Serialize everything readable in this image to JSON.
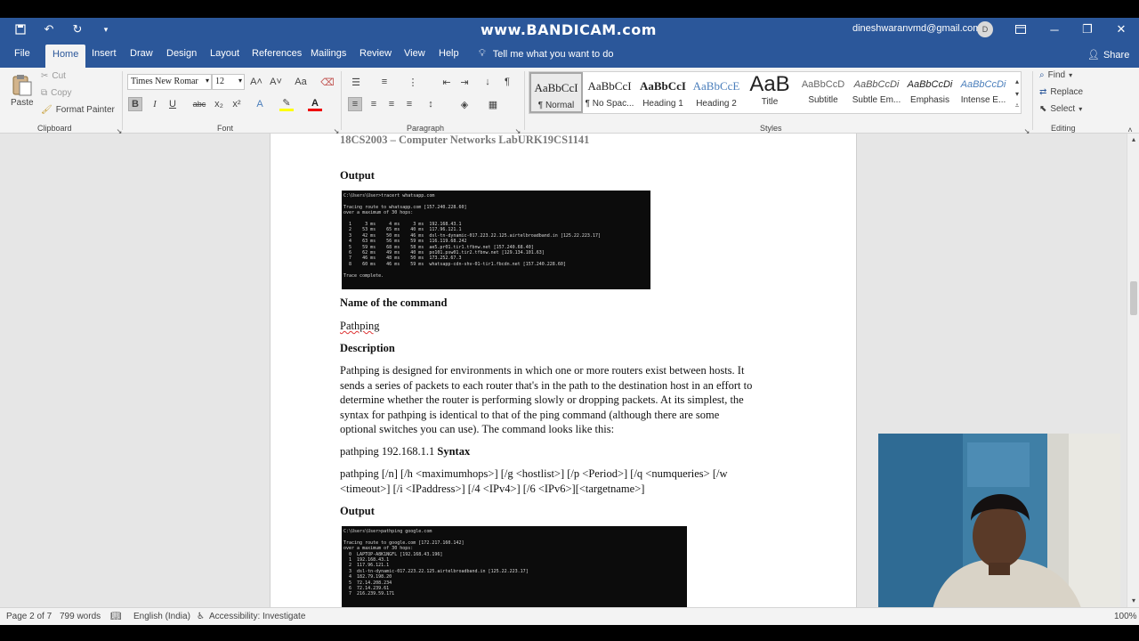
{
  "titlebar": {
    "watermark": "www.BANDICAM.com",
    "account": "dineshwaranvmd@gmail.com",
    "avatar_initial": "D",
    "bg_color": "#2b579a"
  },
  "tabs": [
    {
      "label": "File"
    },
    {
      "label": "Home"
    },
    {
      "label": "Insert"
    },
    {
      "label": "Draw"
    },
    {
      "label": "Design"
    },
    {
      "label": "Layout"
    },
    {
      "label": "References"
    },
    {
      "label": "Mailings"
    },
    {
      "label": "Review"
    },
    {
      "label": "View"
    },
    {
      "label": "Help"
    }
  ],
  "tell_me": "Tell me what you want to do",
  "share": "Share",
  "ribbon": {
    "clipboard": {
      "paste": "Paste",
      "cut": "Cut",
      "copy": "Copy",
      "format_painter": "Format Painter",
      "label": "Clipboard"
    },
    "font": {
      "name": "Times New Romar",
      "size": "12",
      "label": "Font"
    },
    "paragraph": {
      "label": "Paragraph"
    },
    "styles": {
      "label": "Styles",
      "items": [
        {
          "preview": "AaBbCcI",
          "name": "¶ Normal"
        },
        {
          "preview": "AaBbCcI",
          "name": "¶ No Spac..."
        },
        {
          "preview": "AaBbCcI",
          "name": "Heading 1"
        },
        {
          "preview": "AaBbCcE",
          "name": "Heading 2"
        },
        {
          "preview": "AaB",
          "name": "Title"
        },
        {
          "preview": "AaBbCcD",
          "name": "Subtitle"
        },
        {
          "preview": "AaBbCcDi",
          "name": "Subtle Em..."
        },
        {
          "preview": "AaBbCcDi",
          "name": "Emphasis"
        },
        {
          "preview": "AaBbCcDi",
          "name": "Intense E..."
        }
      ]
    },
    "editing": {
      "find": "Find",
      "replace": "Replace",
      "select": "Select",
      "label": "Editing"
    }
  },
  "document": {
    "header": "18CS2003 – Computer Networks LabURK19CS1141",
    "output1": "Output",
    "term1": "C:\\Users\\User>tracert whatsapp.com\n\nTracing route to whatsapp.com [157.240.228.60]\nover a maximum of 30 hops:\n\n  1     3 ms     4 ms     3 ms  192.168.43.1\n  2    53 ms    65 ms    40 ms  117.96.121.1\n  3    42 ms    50 ms    46 ms  dsl-tn-dynamic-017.223.22.125.airtelbroadband.in [125.22.223.17]\n  4    63 ms    56 ms    59 ms  116.119.68.242\n  5    59 ms    68 ms    58 ms  ae5.pr01.tir1.tfbnw.net [157.240.68.40]\n  6    62 ms    49 ms    40 ms  po101.psw01.tir2.tfbnw.net [129.134.101.63]\n  7    46 ms    48 ms    50 ms  173.252.67.3\n  8    60 ms    46 ms    59 ms  whatsapp-cdn-shv-01-tir1.fbcdn.net [157.240.228.60]\n\nTrace complete.",
    "name_heading": "Name of the command",
    "command_name": "Pathping",
    "desc_heading": "Description",
    "desc_lines": [
      "Pathping is designed for environments in which one or more routers exist between hosts. It",
      "sends a series of packets to each router that's in the path to the destination host in an effort to",
      "determine whether the router is performing slowly or dropping packets. At its simplest, the",
      "syntax for pathping is identical to that of the ping command (although there are some",
      "optional switches you can use). The command looks like this:"
    ],
    "example": "pathping 192.168.1.1",
    "syntax_heading": "Syntax",
    "syntax_lines": [
      "pathping [/n] [/h <maximumhops>] [/g <hostlist>] [/p <Period>] [/q <numqueries> [/w",
      "<timeout>] [/i <IPaddress>] [/4 <IPv4>] [/6 <IPv6>][<targetname>]"
    ],
    "output2": "Output",
    "term2": "C:\\Users\\User>pathping google.com\n\nTracing route to google.com [172.217.160.142]\nover a maximum of 30 hops:\n  0  LAPTOP-A8K1NGFL [192.168.43.196]\n  1  192.168.43.1\n  2  117.96.121.1\n  3  dsl-tn-dynamic-017.223.22.125.airtelbroadband.in [125.22.223.17]\n  4  182.79.198.20\n  5  72.14.208.234\n  6  72.14.239.61\n  7  216.239.59.171"
  },
  "status": {
    "page": "Page 2 of 7",
    "words": "799 words",
    "language": "English (India)",
    "accessibility": "Accessibility: Investigate",
    "zoom": "100%"
  }
}
